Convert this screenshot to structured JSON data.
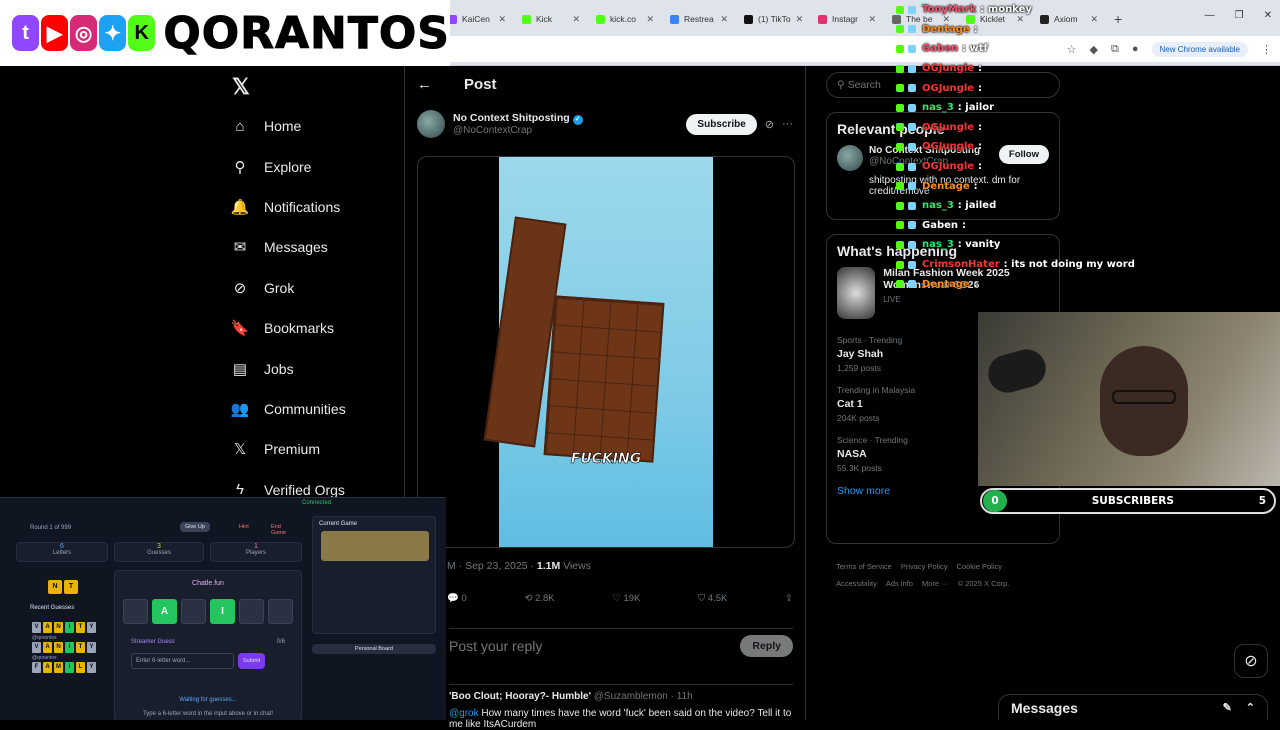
{
  "browser": {
    "tabs": [
      {
        "label": "KaiCen",
        "color": "#9146ff"
      },
      {
        "label": "Kick",
        "color": "#53fc18"
      },
      {
        "label": "kick.co",
        "color": "#53fc18"
      },
      {
        "label": "Restrea",
        "color": "#3b82f6"
      },
      {
        "label": "(1) TikTo",
        "color": "#111111"
      },
      {
        "label": "Instagr",
        "color": "#e1306c"
      },
      {
        "label": "The be",
        "color": "#666666"
      },
      {
        "label": "Kicklet",
        "color": "#53fc18"
      },
      {
        "label": "Axiom",
        "color": "#222222"
      }
    ],
    "update_label": "New Chrome available"
  },
  "overlay": {
    "streamer_name": "QORANTOS"
  },
  "sidebar": {
    "items": [
      {
        "label": "Home",
        "icon": "⌂"
      },
      {
        "label": "Explore",
        "icon": "⚲"
      },
      {
        "label": "Notifications",
        "icon": "🔔"
      },
      {
        "label": "Messages",
        "icon": "✉"
      },
      {
        "label": "Grok",
        "icon": "⊘"
      },
      {
        "label": "Bookmarks",
        "icon": "🔖"
      },
      {
        "label": "Jobs",
        "icon": "▤"
      },
      {
        "label": "Communities",
        "icon": "👥"
      },
      {
        "label": "Premium",
        "icon": "𝕏"
      },
      {
        "label": "Verified Orgs",
        "icon": "ϟ"
      }
    ]
  },
  "post": {
    "header_title": "Post",
    "author_name": "No Context Shitposting",
    "author_handle": "@NoContextCrap",
    "subscribe_label": "Subscribe",
    "video_caption": "FUCKING",
    "date": "M · Sep 23, 2025 · ",
    "views_count": "1.1M",
    "views_label": "Views",
    "stats": {
      "replies": "0",
      "reposts": "2.8K",
      "likes": "19K",
      "bookmarks": "4.5K"
    },
    "reply_placeholder": "Post your reply",
    "reply_button": "Reply"
  },
  "reply_preview": {
    "name": "'Boo Clout; Hooray?- Humble'",
    "handle": "@Suzamblemon · 11h",
    "mention": "@grok",
    "text": " How many times have the word 'fuck' been said on the video? Tell it to me like ItsACurdem"
  },
  "right": {
    "search_placeholder": "Search",
    "relevant_title": "Relevant people",
    "person_name": "No Context Shitposting",
    "person_handle": "@NoContextCrap",
    "follow_label": "Follow",
    "person_bio": "shitposting with no context. dm for credit/remove",
    "happening_title": "What's happening",
    "event_title": "Milan Fashion Week 2025 Womenswear SS26",
    "event_status": "LIVE",
    "trends": [
      {
        "context": "Sports · Trending",
        "name": "Jay Shah",
        "count": "1,259 posts"
      },
      {
        "context": "Trending in Malaysia",
        "name": "Cat 1",
        "count": "204K posts"
      },
      {
        "context": "Science · Trending",
        "name": "NASA",
        "count": "55.3K posts"
      }
    ],
    "show_more": "Show more",
    "footer": [
      "Terms of Service",
      "Privacy Policy",
      "Cookie Policy",
      "Accessibility",
      "Ads info",
      "More ···",
      "© 2025 X Corp."
    ]
  },
  "chat": [
    {
      "user": "TonyMark",
      "text": ": monkey",
      "color": "#ff4d6d"
    },
    {
      "user": "Dentage",
      "text": ":",
      "color": "#ff8c1a"
    },
    {
      "user": "Gaben",
      "text": ": wtf",
      "color": "#ff4d6d"
    },
    {
      "user": "OGJungle",
      "text": ":",
      "color": "#ff3030"
    },
    {
      "user": "OGJungle",
      "text": ":",
      "color": "#ff3030"
    },
    {
      "user": "nas_3",
      "text": ": jailor",
      "color": "#2ee86c"
    },
    {
      "user": "OGJungle",
      "text": ":",
      "color": "#ff3030"
    },
    {
      "user": "OGJungle",
      "text": ":",
      "color": "#ff3030"
    },
    {
      "user": "OGJungle",
      "text": ":",
      "color": "#ff3030"
    },
    {
      "user": "Dentage",
      "text": ":",
      "color": "#ff8c1a"
    },
    {
      "user": "nas_3",
      "text": ": jailed",
      "color": "#2ee86c"
    },
    {
      "user": "Gaben",
      "text": ":",
      "color": "#ffffff"
    },
    {
      "user": "nas_3",
      "text": ": vanity",
      "color": "#2ee86c"
    },
    {
      "user": "CrimsonHater",
      "text": ": its not doing my word",
      "color": "#ff3030"
    },
    {
      "user": "Dentage",
      "text": ":",
      "color": "#ff8c1a"
    }
  ],
  "subs": {
    "current": "0",
    "label": "SUBSCRIBERS",
    "goal": "5",
    "progress": 0
  },
  "dm_drawer": {
    "title": "Messages"
  },
  "game": {
    "round_label": "Round 1 of 999",
    "give_up": "Give Up",
    "hint": "Hint",
    "end_game": "End Game",
    "connected": "Connected",
    "letters_label": "Letters",
    "letters_value": "6",
    "guesses_label": "Guesses",
    "guesses_value": "3",
    "players_label": "Players",
    "players_value": "1",
    "site_name": "Chatle.fun",
    "revealed": [
      "N",
      "T"
    ],
    "board": [
      "",
      "A",
      "",
      "I",
      "",
      ""
    ],
    "recent_label": "Recent Guesses",
    "recent": [
      {
        "word": [
          "V",
          "A",
          "N",
          "I",
          "T",
          "Y"
        ],
        "user": "@qorantos"
      },
      {
        "word": [
          "V",
          "A",
          "N",
          "I",
          "T",
          "Y"
        ],
        "user": "@qorantos"
      },
      {
        "word": [
          "F",
          "A",
          "M",
          "I",
          "L",
          "Y"
        ],
        "user": ""
      }
    ],
    "streamer_guess": "Streamer Guess",
    "guess_count": "0/6",
    "input_placeholder": "Enter 6-letter word...",
    "submit": "Submit",
    "waiting": "Waiting for guesses...",
    "waiting_hint": "Type a 6-letter word in the input above or in chat!",
    "current_game": "Current Game",
    "personal_board": "Personal Board"
  }
}
